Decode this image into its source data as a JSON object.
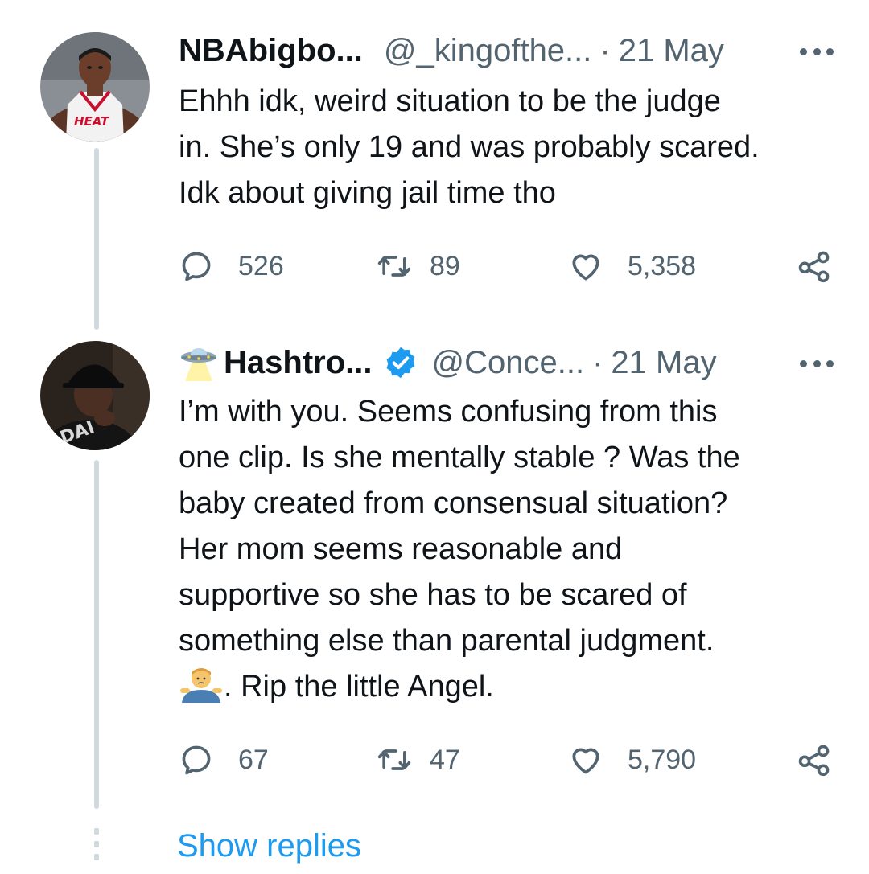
{
  "tweets": [
    {
      "display_name": "NBAbigbo...",
      "handle": "@_kingofthe...",
      "separator": "·",
      "date": "21 May",
      "lines": [
        "Ehhh idk, weird situation to be the judge",
        "in. She’s only 19 and was probably scared.",
        "Idk about giving jail time tho"
      ],
      "replies": "526",
      "retweets": "89",
      "likes": "5,358",
      "avatar_jersey_text": "HEAT"
    },
    {
      "display_name": "Hashtro...",
      "handle": "@Conce...",
      "separator": "·",
      "date": "21 May",
      "verified": true,
      "name_emoji": "ufo-icon",
      "lines": [
        "I’m with you. Seems confusing from this",
        "one clip. Is she mentally stable ? Was the",
        "baby created from consensual situation?",
        "Her mom seems reasonable and",
        "supportive so she has to be scared of",
        "something else than parental judgment."
      ],
      "last_line": ". Rip the little Angel.",
      "last_line_emoji": "shrug-emoji-icon",
      "replies": "67",
      "retweets": "47",
      "likes": "5,790"
    }
  ],
  "show_replies_label": "Show replies",
  "colors": {
    "text": "#0f1419",
    "secondary": "#536471",
    "link": "#1d9bf0",
    "thread_line": "#cfd9de",
    "verified": "#1d9bf0"
  }
}
